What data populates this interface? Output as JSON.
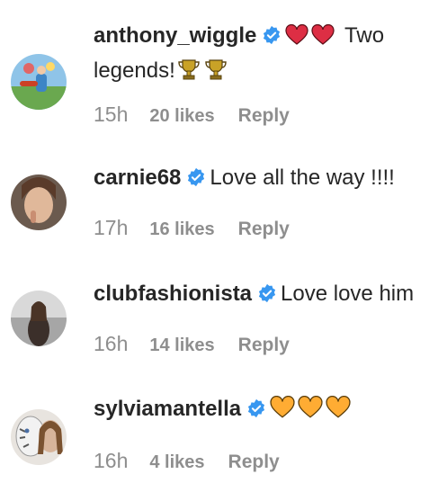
{
  "colors": {
    "verified": "#3897f0",
    "heart_red": "#dd2e44",
    "heart_yellow": "#ffac33",
    "trophy": "#c9a227",
    "meta": "#8e8e8e",
    "text": "#262626"
  },
  "comments": [
    {
      "username": "anthony_wiggle",
      "verified": true,
      "text_line1": "Two",
      "text_line2": "legends!",
      "emoji_before": [
        "red-heart",
        "red-heart"
      ],
      "emoji_after": [
        "trophy",
        "trophy"
      ],
      "time": "15h",
      "likes": "20 likes",
      "reply": "Reply"
    },
    {
      "username": "carnie68",
      "verified": true,
      "text": "Love all the way !!!!",
      "time": "17h",
      "likes": "16 likes",
      "reply": "Reply"
    },
    {
      "username": "clubfashionista",
      "verified": true,
      "text": "Love love him",
      "time": "16h",
      "likes": "14 likes",
      "reply": "Reply"
    },
    {
      "username": "sylviamantella",
      "verified": true,
      "emoji_after": [
        "yellow-heart",
        "yellow-heart",
        "yellow-heart"
      ],
      "time": "16h",
      "likes": "4 likes",
      "reply": "Reply"
    }
  ]
}
